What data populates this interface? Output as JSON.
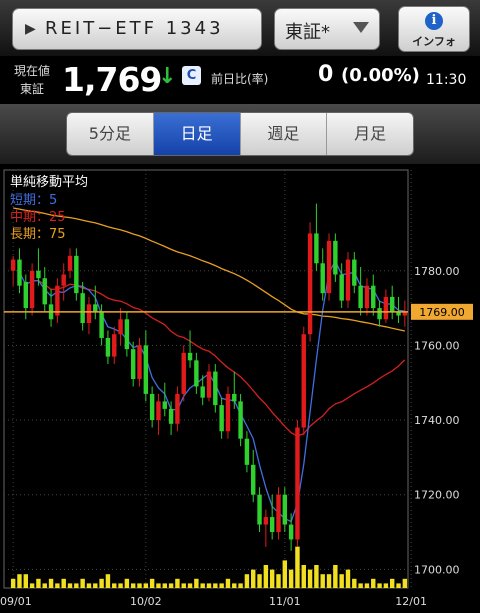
{
  "header": {
    "symbol_label": "REIT−ETF 1343",
    "market_label": "東証*",
    "info_label": "インフォ"
  },
  "quote": {
    "label_line1": "現在値",
    "label_line2": "東証",
    "price": "1,769",
    "direction_marker": "C",
    "change_label": "前日比(率)",
    "change": "0",
    "change_pct": "(0.00%)",
    "time": "11:30"
  },
  "tabs": [
    {
      "label": "5分足",
      "active": false
    },
    {
      "label": "日足",
      "active": true
    },
    {
      "label": "週足",
      "active": false
    },
    {
      "label": "月足",
      "active": false
    }
  ],
  "colors": {
    "up": "#e01b1b",
    "down": "#2ed12e",
    "ma_short": "#3f6fe0",
    "ma_mid": "#d42020",
    "ma_long": "#e8a020",
    "price_line": "#f0a830",
    "volume": "#f0e020"
  },
  "chart_data": {
    "type": "candlestick",
    "legend": {
      "title": "単純移動平均",
      "items": [
        {
          "label": "短期：5",
          "color": "#3f6fe0"
        },
        {
          "label": "中期：25",
          "color": "#d42020"
        },
        {
          "label": "長期：75",
          "color": "#e8a020"
        }
      ]
    },
    "y_ticks": [
      "1780.00",
      "1760.00",
      "1740.00",
      "1720.00",
      "1700.00"
    ],
    "y_tick_values": [
      1780,
      1760,
      1740,
      1720,
      1700
    ],
    "ylim": [
      1695,
      1807
    ],
    "current_price": 1769,
    "current_price_label": "1769.00",
    "x_ticks": [
      "09/01",
      "10/02",
      "11/01",
      "12/01"
    ],
    "x_tick_index": [
      0,
      21,
      43,
      63
    ],
    "ohlc": [
      [
        1780,
        1784,
        1776,
        1783
      ],
      [
        1783,
        1786,
        1774,
        1776
      ],
      [
        1777,
        1779,
        1767,
        1770
      ],
      [
        1770,
        1782,
        1768,
        1780
      ],
      [
        1780,
        1786,
        1776,
        1778
      ],
      [
        1778,
        1781,
        1769,
        1771
      ],
      [
        1771,
        1775,
        1765,
        1767
      ],
      [
        1768,
        1778,
        1766,
        1776
      ],
      [
        1776,
        1782,
        1772,
        1779
      ],
      [
        1780,
        1786,
        1778,
        1784
      ],
      [
        1784,
        1786,
        1772,
        1774
      ],
      [
        1774,
        1777,
        1764,
        1766
      ],
      [
        1766,
        1773,
        1763,
        1771
      ],
      [
        1771,
        1776,
        1767,
        1769
      ],
      [
        1769,
        1771,
        1760,
        1762
      ],
      [
        1762,
        1764,
        1755,
        1757
      ],
      [
        1757,
        1765,
        1755,
        1763
      ],
      [
        1763,
        1770,
        1760,
        1767
      ],
      [
        1767,
        1769,
        1757,
        1759
      ],
      [
        1759,
        1761,
        1749,
        1751
      ],
      [
        1751,
        1762,
        1749,
        1760
      ],
      [
        1760,
        1764,
        1745,
        1747
      ],
      [
        1747,
        1749,
        1738,
        1740
      ],
      [
        1740,
        1747,
        1736,
        1745
      ],
      [
        1745,
        1750,
        1741,
        1743
      ],
      [
        1743,
        1745,
        1736,
        1739
      ],
      [
        1739,
        1749,
        1737,
        1747
      ],
      [
        1747,
        1760,
        1745,
        1758
      ],
      [
        1758,
        1764,
        1754,
        1756
      ],
      [
        1756,
        1758,
        1747,
        1749
      ],
      [
        1749,
        1752,
        1744,
        1746
      ],
      [
        1746,
        1755,
        1745,
        1753
      ],
      [
        1753,
        1755,
        1742,
        1744
      ],
      [
        1744,
        1746,
        1735,
        1737
      ],
      [
        1737,
        1749,
        1735,
        1747
      ],
      [
        1747,
        1753,
        1743,
        1745
      ],
      [
        1745,
        1747,
        1733,
        1735
      ],
      [
        1735,
        1737,
        1726,
        1728
      ],
      [
        1728,
        1732,
        1718,
        1720
      ],
      [
        1720,
        1722,
        1710,
        1712
      ],
      [
        1712,
        1716,
        1706,
        1714
      ],
      [
        1714,
        1720,
        1708,
        1710
      ],
      [
        1710,
        1722,
        1708,
        1720
      ],
      [
        1720,
        1722,
        1710,
        1712
      ],
      [
        1712,
        1715,
        1705,
        1708
      ],
      [
        1708,
        1740,
        1706,
        1738
      ],
      [
        1738,
        1765,
        1736,
        1763
      ],
      [
        1763,
        1793,
        1761,
        1790
      ],
      [
        1790,
        1798,
        1780,
        1782
      ],
      [
        1782,
        1786,
        1772,
        1774
      ],
      [
        1774,
        1790,
        1772,
        1788
      ],
      [
        1788,
        1790,
        1777,
        1779
      ],
      [
        1779,
        1782,
        1770,
        1772
      ],
      [
        1772,
        1785,
        1770,
        1783
      ],
      [
        1783,
        1785,
        1774,
        1776
      ],
      [
        1776,
        1781,
        1768,
        1770
      ],
      [
        1770,
        1778,
        1768,
        1776
      ],
      [
        1776,
        1779,
        1768,
        1770
      ],
      [
        1770,
        1772,
        1765,
        1767
      ],
      [
        1767,
        1775,
        1766,
        1773
      ],
      [
        1773,
        1776,
        1767,
        1769
      ],
      [
        1769,
        1773,
        1766,
        1768
      ],
      [
        1768,
        1772,
        1765,
        1769
      ]
    ],
    "volume": [
      2,
      3,
      3,
      1,
      2,
      1,
      2,
      1,
      2,
      1,
      1,
      2,
      1,
      1,
      2,
      3,
      1,
      1,
      2,
      1,
      1,
      1,
      2,
      1,
      1,
      1,
      2,
      1,
      1,
      2,
      1,
      1,
      1,
      1,
      2,
      1,
      1,
      3,
      4,
      3,
      5,
      4,
      3,
      6,
      4,
      9,
      5,
      4,
      5,
      3,
      3,
      5,
      3,
      4,
      2,
      1,
      1,
      2,
      1,
      1,
      2,
      1,
      2
    ],
    "volume_max": 10
  }
}
